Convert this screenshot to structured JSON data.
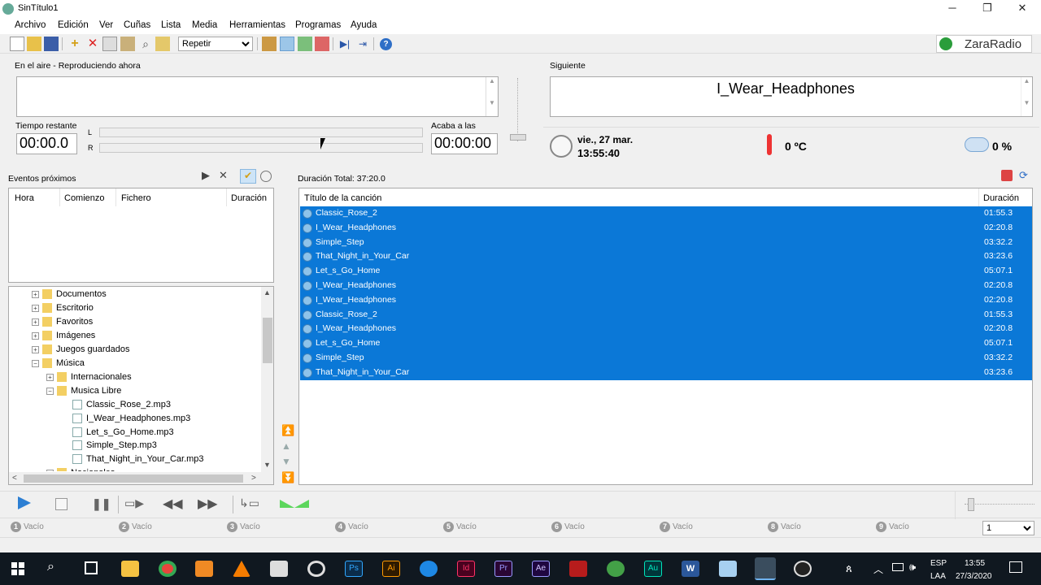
{
  "window": {
    "title": "SinTítulo1"
  },
  "menu": [
    "Archivo",
    "Edición",
    "Ver",
    "Cuñas",
    "Lista",
    "Media",
    "Herramientas",
    "Programas",
    "Ayuda"
  ],
  "toolbar": {
    "mode_select": "Repetir"
  },
  "brand": "ZaraRadio",
  "on_air": {
    "label": "En el aire - Reproduciendo ahora",
    "remaining_label": "Tiempo restante",
    "remaining": "00:00.0",
    "ends_label": "Acaba a las",
    "ends": "00:00:00",
    "channel_l": "L",
    "channel_r": "R"
  },
  "next": {
    "label": "Siguiente",
    "title": "I_Wear_Headphones"
  },
  "info": {
    "date": "vie., 27 mar.",
    "time": "13:55:40",
    "temperature": "0 ºC",
    "humidity": "0 %"
  },
  "events": {
    "label": "Eventos próximos",
    "columns": [
      "Hora",
      "Comienzo",
      "Fichero",
      "Duración"
    ]
  },
  "tree": [
    {
      "label": "Documentos",
      "level": 1
    },
    {
      "label": "Escritorio",
      "level": 1
    },
    {
      "label": "Favoritos",
      "level": 1
    },
    {
      "label": "Imágenes",
      "level": 1
    },
    {
      "label": "Juegos guardados",
      "level": 1
    },
    {
      "label": "Música",
      "level": 1
    },
    {
      "label": "Internacionales",
      "level": 2
    },
    {
      "label": "Musica Libre",
      "level": 2
    },
    {
      "label": "Classic_Rose_2.mp3",
      "level": 3
    },
    {
      "label": "I_Wear_Headphones.mp3",
      "level": 3
    },
    {
      "label": "Let_s_Go_Home.mp3",
      "level": 3
    },
    {
      "label": "Simple_Step.mp3",
      "level": 3
    },
    {
      "label": "That_Night_in_Your_Car.mp3",
      "level": 3
    },
    {
      "label": "Nacionales",
      "level": 2
    }
  ],
  "playlist": {
    "total_label": "Duración Total: 37:20.0",
    "col_title": "Título de la canción",
    "col_duration": "Duración",
    "rows": [
      {
        "title": "Classic_Rose_2",
        "duration": "01:55.3"
      },
      {
        "title": "I_Wear_Headphones",
        "duration": "02:20.8"
      },
      {
        "title": "Simple_Step",
        "duration": "03:32.2"
      },
      {
        "title": "That_Night_in_Your_Car",
        "duration": "03:23.6"
      },
      {
        "title": "Let_s_Go_Home",
        "duration": "05:07.1"
      },
      {
        "title": "I_Wear_Headphones",
        "duration": "02:20.8"
      },
      {
        "title": "I_Wear_Headphones",
        "duration": "02:20.8"
      },
      {
        "title": "Classic_Rose_2",
        "duration": "01:55.3"
      },
      {
        "title": "I_Wear_Headphones",
        "duration": "02:20.8"
      },
      {
        "title": "Let_s_Go_Home",
        "duration": "05:07.1"
      },
      {
        "title": "Simple_Step",
        "duration": "03:32.2"
      },
      {
        "title": "That_Night_in_Your_Car",
        "duration": "03:23.6"
      }
    ]
  },
  "slots": [
    {
      "n": "1",
      "label": "Vacío"
    },
    {
      "n": "2",
      "label": "Vacío"
    },
    {
      "n": "3",
      "label": "Vacío"
    },
    {
      "n": "4",
      "label": "Vacío"
    },
    {
      "n": "5",
      "label": "Vacío"
    },
    {
      "n": "6",
      "label": "Vacío"
    },
    {
      "n": "7",
      "label": "Vacío"
    },
    {
      "n": "8",
      "label": "Vacío"
    },
    {
      "n": "9",
      "label": "Vacío"
    }
  ],
  "slot_page": "1",
  "taskbar": {
    "lang1": "ESP",
    "lang2": "LAA",
    "clock_time": "13:55",
    "clock_date": "27/3/2020"
  }
}
